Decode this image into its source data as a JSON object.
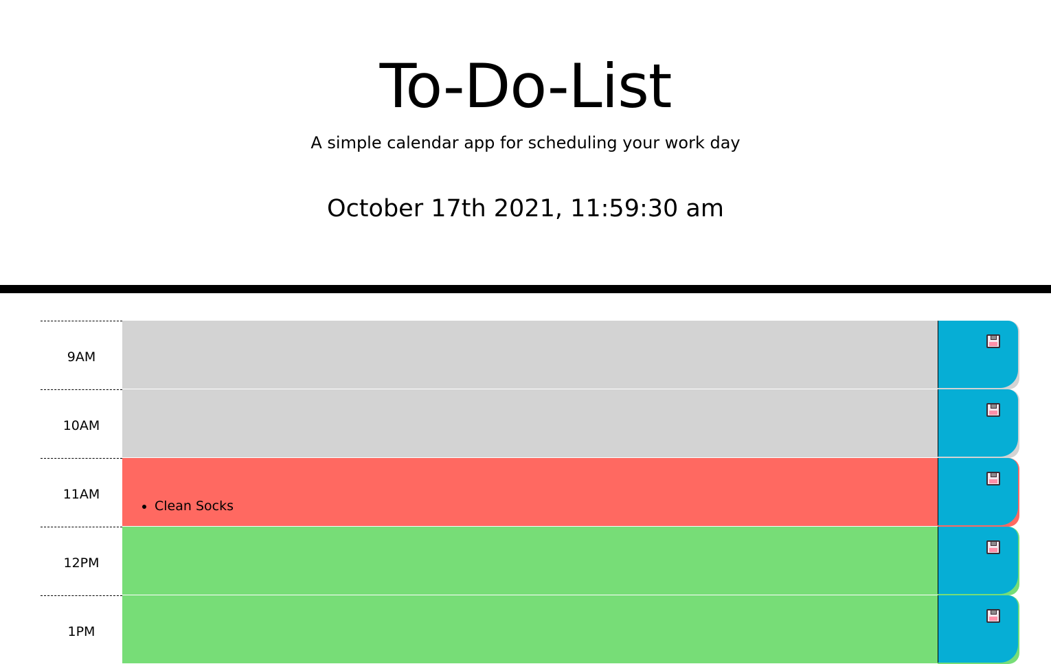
{
  "header": {
    "title": "To-Do-List",
    "subtitle": "A simple calendar app for scheduling your work day",
    "current_day": "October 17th 2021, 11:59:30 am"
  },
  "colors": {
    "past": "#d3d3d3",
    "present": "#ff6961",
    "future": "#77dd77",
    "save_button": "#06aed5"
  },
  "icons": {
    "save": "floppy-disk-icon"
  },
  "timeblocks": [
    {
      "hour": "9AM",
      "state": "past",
      "items": []
    },
    {
      "hour": "10AM",
      "state": "past",
      "items": []
    },
    {
      "hour": "11AM",
      "state": "present",
      "items": [
        "Clean Socks"
      ]
    },
    {
      "hour": "12PM",
      "state": "future",
      "items": []
    },
    {
      "hour": "1PM",
      "state": "future",
      "items": []
    }
  ]
}
